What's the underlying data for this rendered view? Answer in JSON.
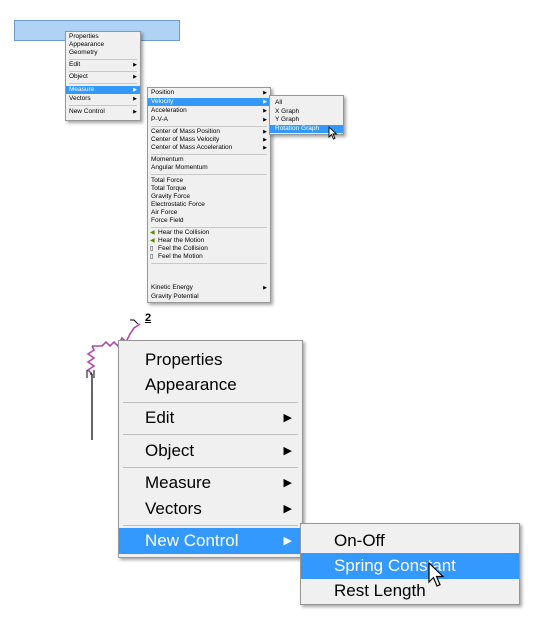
{
  "top": {
    "main_menu": [
      {
        "label": "Properties",
        "arrow": ""
      },
      {
        "label": "Appearance",
        "arrow": ""
      },
      {
        "label": "Geometry",
        "arrow": ""
      },
      {
        "label": "Edit",
        "arrow": "▶"
      },
      {
        "label": "Object",
        "arrow": "▶"
      },
      {
        "label": "Measure",
        "arrow": "▶"
      },
      {
        "label": "Vectors",
        "arrow": "▶"
      },
      {
        "label": "New Control",
        "arrow": "▶"
      }
    ],
    "measure_menu": [
      {
        "label": "Position",
        "arrow": "▶"
      },
      {
        "label": "Velocity",
        "arrow": "▶"
      },
      {
        "label": "Acceleration",
        "arrow": "▶"
      },
      {
        "label": "P-V-A",
        "arrow": "▶"
      },
      {
        "label": "Center of Mass Position",
        "arrow": "▶"
      },
      {
        "label": "Center of Mass Velocity",
        "arrow": "▶"
      },
      {
        "label": "Center of Mass Acceleration",
        "arrow": "▶"
      },
      {
        "label": "Momentum",
        "arrow": ""
      },
      {
        "label": "Angular Momentum",
        "arrow": ""
      },
      {
        "label": "Total Force",
        "arrow": ""
      },
      {
        "label": "Total Torque",
        "arrow": ""
      },
      {
        "label": "Gravity Force",
        "arrow": ""
      },
      {
        "label": "Electrostatic Force",
        "arrow": ""
      },
      {
        "label": "Air Force",
        "arrow": ""
      },
      {
        "label": "Force Field",
        "arrow": ""
      },
      {
        "label": "Hear the Collision",
        "arrow": ""
      },
      {
        "label": "Hear the Motion",
        "arrow": ""
      },
      {
        "label": "Feel the Collision",
        "arrow": ""
      },
      {
        "label": "Feel the Motion",
        "arrow": ""
      },
      {
        "label": "Kinetic Energy",
        "arrow": "▶"
      },
      {
        "label": "Gravity Potential",
        "arrow": ""
      }
    ],
    "velocity_menu": [
      {
        "label": "All",
        "arrow": ""
      },
      {
        "label": "X Graph",
        "arrow": ""
      },
      {
        "label": "Y Graph",
        "arrow": ""
      },
      {
        "label": "Rotation Graph",
        "arrow": ""
      }
    ]
  },
  "bottom": {
    "spring_label": "2",
    "main_menu": [
      {
        "label": "Properties",
        "arrow": ""
      },
      {
        "label": "Appearance",
        "arrow": ""
      },
      {
        "label": "Edit",
        "arrow": "▶"
      },
      {
        "label": "Object",
        "arrow": "▶"
      },
      {
        "label": "Measure",
        "arrow": "▶"
      },
      {
        "label": "Vectors",
        "arrow": "▶"
      },
      {
        "label": "New Control",
        "arrow": "▶"
      }
    ],
    "new_control_menu": [
      {
        "label": "On-Off",
        "arrow": ""
      },
      {
        "label": "Spring Constant",
        "arrow": ""
      },
      {
        "label": "Rest Length",
        "arrow": ""
      }
    ]
  },
  "colors": {
    "highlight": "#3399ff",
    "titlebar": "#aed3f5",
    "menu_bg": "#f0f0f0"
  }
}
